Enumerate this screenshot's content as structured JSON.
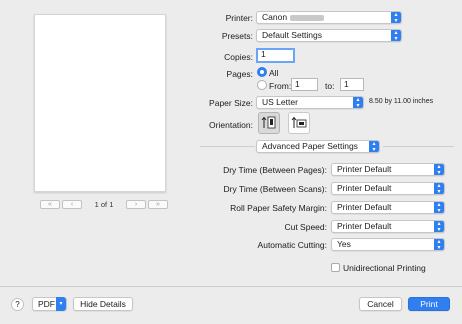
{
  "preview": {
    "page_count": "1 of 1",
    "first_glyph": "«",
    "prev_glyph": "‹",
    "next_glyph": "›",
    "last_glyph": "»"
  },
  "printer": {
    "label": "Printer:",
    "value": "Canon"
  },
  "presets": {
    "label": "Presets:",
    "value": "Default Settings"
  },
  "copies": {
    "label": "Copies:",
    "value": "1"
  },
  "pages": {
    "label": "Pages:",
    "all_label": "All",
    "from_label": "From:",
    "from_value": "1",
    "to_label": "to:",
    "to_value": "1",
    "selected": "All"
  },
  "paper_size": {
    "label": "Paper Size:",
    "value": "US Letter",
    "dimensions": "8.50 by 11.00 inches"
  },
  "orientation": {
    "label": "Orientation:",
    "selected": "portrait"
  },
  "section_menu": {
    "value": "Advanced Paper Settings"
  },
  "advanced": [
    {
      "label": "Dry Time (Between Pages):",
      "value": "Printer Default"
    },
    {
      "label": "Dry Time (Between Scans):",
      "value": "Printer Default"
    },
    {
      "label": "Roll Paper Safety Margin:",
      "value": "Printer Default"
    },
    {
      "label": "Cut Speed:",
      "value": "Printer Default"
    },
    {
      "label": "Automatic Cutting:",
      "value": "Yes"
    }
  ],
  "unidirectional": {
    "label": "Unidirectional Printing",
    "checked": false
  },
  "footer": {
    "help": "?",
    "pdf": "PDF",
    "hide_details": "Hide Details",
    "cancel": "Cancel",
    "print": "Print"
  },
  "colors": {
    "accent": "#2f7ff0",
    "background": "#ececec"
  },
  "icons": {
    "popup_arrow": "up-down-chevron-icon",
    "portrait": "portrait-orientation-icon",
    "landscape": "landscape-orientation-icon"
  }
}
